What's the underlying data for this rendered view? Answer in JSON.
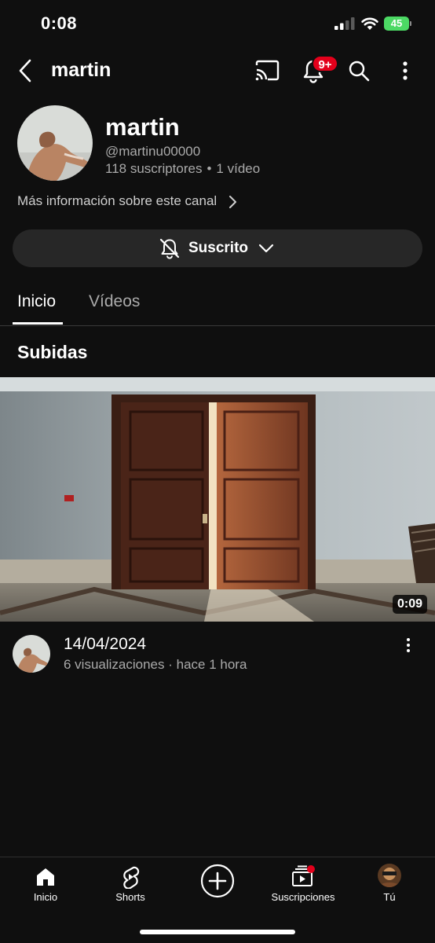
{
  "status_bar": {
    "time": "0:08",
    "battery": "45"
  },
  "header": {
    "title": "martin",
    "notifications_badge": "9+"
  },
  "channel": {
    "name": "martin",
    "handle": "@martinu00000",
    "subscribers": "118 suscriptores",
    "separator": "•",
    "video_count": "1 vídeo",
    "more_info": "Más información sobre este canal"
  },
  "subscribe": {
    "label": "Suscrito"
  },
  "tabs": [
    {
      "label": "Inicio",
      "active": true
    },
    {
      "label": "Vídeos",
      "active": false
    }
  ],
  "section": {
    "title": "Subidas"
  },
  "video": {
    "duration": "0:09",
    "title": "14/04/2024",
    "stats": "6 visualizaciones · hace 1 hora"
  },
  "bottom_nav": {
    "items": [
      {
        "label": "Inicio",
        "icon": "home-icon"
      },
      {
        "label": "Shorts",
        "icon": "shorts-icon"
      },
      {
        "label": "",
        "icon": "create-icon"
      },
      {
        "label": "Suscripciones",
        "icon": "subscriptions-icon"
      },
      {
        "label": "Tú",
        "icon": "profile-avatar"
      }
    ]
  },
  "colors": {
    "background": "#0f0f0f",
    "accent_red": "#e3001b",
    "secondary_text": "#aaaaaa",
    "button_bg": "#272727",
    "battery_green": "#4cd964"
  }
}
